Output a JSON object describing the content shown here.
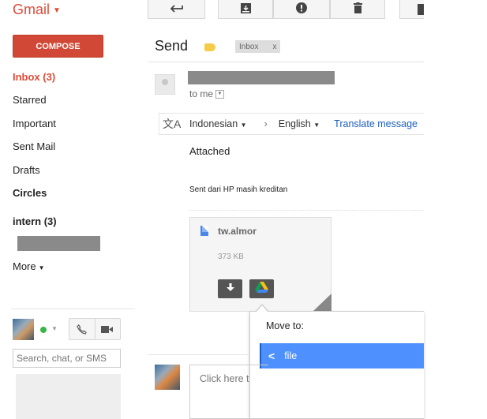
{
  "app": {
    "logo": "Gmail"
  },
  "compose": {
    "label": "COMPOSE"
  },
  "nav": [
    {
      "label": "Inbox (3)"
    },
    {
      "label": "Starred"
    },
    {
      "label": "Important"
    },
    {
      "label": "Sent Mail"
    },
    {
      "label": "Drafts"
    },
    {
      "label": "Circles"
    },
    {
      "label": "intern (3)"
    }
  ],
  "more": {
    "label": "More"
  },
  "chat": {
    "search_placeholder": "Search, chat, or SMS"
  },
  "toolbar": {
    "back_icon": "back-arrow-icon",
    "archive_icon": "archive-icon",
    "spam_icon": "report-spam-icon",
    "delete_icon": "trash-icon"
  },
  "message": {
    "subject": "Send",
    "label_chip": {
      "text": "Inbox",
      "close": "x"
    },
    "to_me": "to me",
    "translate": {
      "from_lang": "Indonesian",
      "to_lang": "English",
      "action": "Translate message"
    },
    "body_line1": "Attached",
    "signature": "Sent dari HP masih kreditan"
  },
  "attachment": {
    "filename": "tw.almor",
    "size": "373 KB"
  },
  "move_popup": {
    "title": "Move to:",
    "item": "file"
  },
  "reply": {
    "placeholder": "Click here t"
  },
  "colors": {
    "brand_red": "#dd4b39",
    "compose_red": "#d14836",
    "link_blue": "#1a5ebf",
    "selected_blue": "#4d90fe"
  }
}
